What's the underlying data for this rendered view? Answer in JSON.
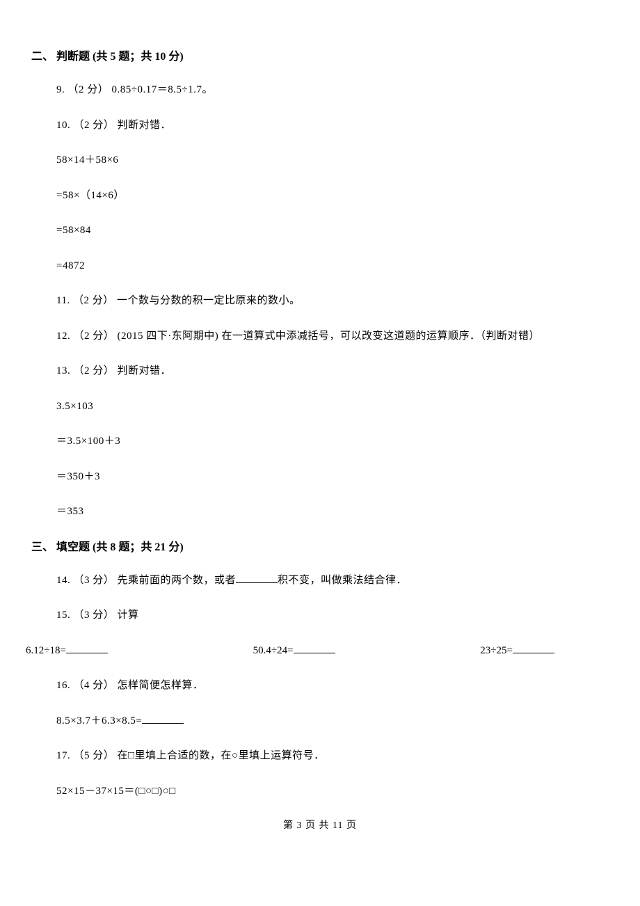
{
  "section2": {
    "heading": "二、 判断题 (共 5 题；共 10 分)",
    "q9": "9. （2 分） 0.85÷0.17＝8.5÷1.7。",
    "q10_head": "10. （2 分） 判断对错．",
    "q10_l1": "58×14＋58×6",
    "q10_l2": "=58×（14×6）",
    "q10_l3": "=58×84",
    "q10_l4": "=4872",
    "q11": "11. （2 分） 一个数与分数的积一定比原来的数小。",
    "q12": "12. （2 分） (2015 四下·东阿期中) 在一道算式中添减括号，可以改变这道题的运算顺序．（判断对错）",
    "q13_head": "13. （2 分） 判断对错．",
    "q13_l1": "3.5×103",
    "q13_l2": "＝3.5×100＋3",
    "q13_l3": "＝350＋3",
    "q13_l4": "＝353"
  },
  "section3": {
    "heading": "三、 填空题 (共 8 题；共 21 分)",
    "q14_pre": "14. （3 分） 先乘前面的两个数，或者",
    "q14_post": "积不变，叫做乘法结合律．",
    "q15_head": "15. （3 分） 计算",
    "q15_c1_pre": "6.12÷18=",
    "q15_c2_pre": "50.4÷24=",
    "q15_c3_pre": "23÷25=",
    "q16_head": "16. （4 分） 怎样简便怎样算．",
    "q16_l1_pre": "8.5×3.7＋6.3×8.5=",
    "q17_head": "17. （5 分） 在□里填上合适的数，在○里填上运算符号．",
    "q17_l1": "52×15－37×15＝(□○□)○□"
  },
  "footer": "第 3 页 共 11 页"
}
